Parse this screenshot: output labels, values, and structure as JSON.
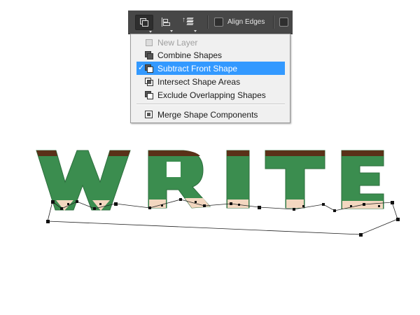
{
  "toolbar": {
    "align_edges_label": "Align Edges",
    "align_edges_checked": false,
    "icons": [
      "path-operations-icon",
      "path-alignment-icon",
      "path-arrangement-icon"
    ]
  },
  "menu": {
    "items": [
      {
        "label": "New Layer",
        "icon": "new-layer-icon",
        "state": "disabled"
      },
      {
        "label": "Combine Shapes",
        "icon": "combine-shapes-icon",
        "state": "normal"
      },
      {
        "label": "Subtract Front Shape",
        "icon": "subtract-front-shape-icon",
        "state": "selected",
        "checked": true
      },
      {
        "label": "Intersect Shape Areas",
        "icon": "intersect-shape-areas-icon",
        "state": "normal"
      },
      {
        "label": "Exclude Overlapping Shapes",
        "icon": "exclude-overlapping-shapes-icon",
        "state": "normal"
      },
      {
        "label": "Merge Shape Components",
        "icon": "merge-shape-components-icon",
        "state": "normal"
      }
    ],
    "check_mark": "✓",
    "highlight_color": "#3399ff"
  },
  "artwork": {
    "letters": [
      "W",
      "R",
      "I",
      "T",
      "E"
    ],
    "fill_color": "#3b8d4f",
    "top_band_color": "#5a3118",
    "bottom_color": "#f3d7c0"
  }
}
